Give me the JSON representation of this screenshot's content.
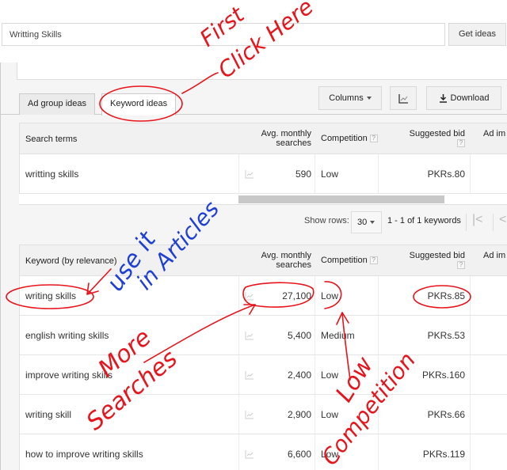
{
  "search": {
    "value": "Writting Skills",
    "button_label": "Get ideas"
  },
  "tabs": [
    {
      "label": "Ad group ideas",
      "active": false
    },
    {
      "label": "Keyword ideas",
      "active": true
    }
  ],
  "toolbar": {
    "columns_label": "Columns",
    "download_label": "Download",
    "chart_icon": "chart-icon",
    "download_icon": "download-icon"
  },
  "search_terms_table": {
    "headers": {
      "keyword": "Search terms",
      "searches_line1": "Avg. monthly",
      "searches_line2": "searches",
      "competition": "Competition",
      "bid": "Suggested bid",
      "impr": "Ad im"
    },
    "rows": [
      {
        "keyword": "writting skills",
        "searches": "590",
        "competition": "Low",
        "bid": "PKRs.80"
      }
    ]
  },
  "pager": {
    "show_rows_label": "Show rows:",
    "rows_value": "30",
    "range": "1 - 1 of 1 keywords"
  },
  "keyword_table": {
    "headers": {
      "keyword": "Keyword (by relevance)",
      "searches_line1": "Avg. monthly",
      "searches_line2": "searches",
      "competition": "Competition",
      "bid": "Suggested bid",
      "impr": "Ad im"
    },
    "rows": [
      {
        "keyword": "writing skills",
        "searches": "27,100",
        "competition": "Low",
        "bid": "PKRs.85"
      },
      {
        "keyword": "english writing skills",
        "searches": "5,400",
        "competition": "Medium",
        "bid": "PKRs.53"
      },
      {
        "keyword": "improve writing skills",
        "searches": "2,400",
        "competition": "Low",
        "bid": "PKRs.160"
      },
      {
        "keyword": "writing skill",
        "searches": "2,900",
        "competition": "Low",
        "bid": "PKRs.66"
      },
      {
        "keyword": "how to improve writing skills",
        "searches": "6,600",
        "competition": "Low",
        "bid": "PKRs.119"
      }
    ]
  },
  "annotations": {
    "first_click_here": "First Click Here",
    "use_it_in_articles": "use it in Articles",
    "more_searches": "More Searches",
    "low_competition": "Low Competition",
    "red": "#e8141b",
    "blue": "#1f3fd6"
  }
}
